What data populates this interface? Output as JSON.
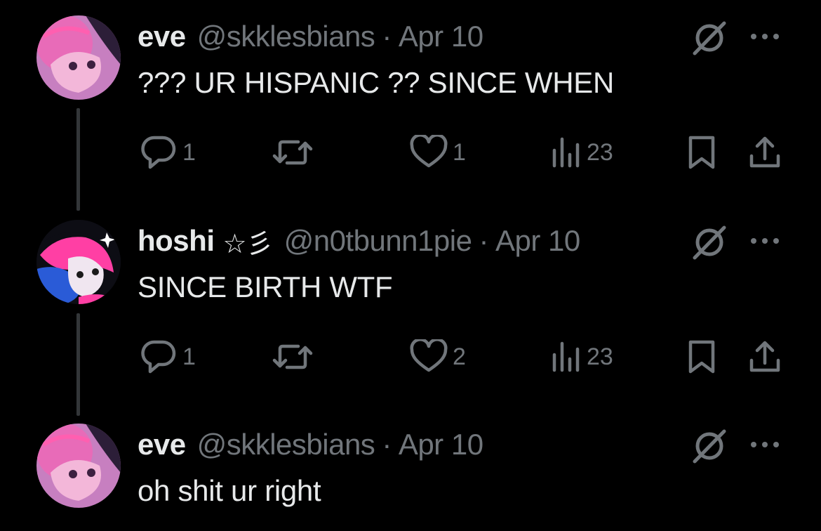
{
  "colors": {
    "background": "#000000",
    "text_primary": "#e7e9ea",
    "text_secondary": "#71767b",
    "thread_line": "#333639",
    "avatar_pink": "#e040a0",
    "avatar_blue": "#2a5bd7"
  },
  "posts": [
    {
      "display_name": "eve",
      "name_decoration": "",
      "handle": "@skklesbians",
      "separator": "·",
      "date": "Apr 10",
      "text": "??? UR HISPANIC ?? SINCE WHEN",
      "replies": "1",
      "reposts": "",
      "likes": "1",
      "views": "23",
      "avatar_icon": "avatar-image",
      "grok_icon": "grok-icon",
      "more_icon": "more-icon"
    },
    {
      "display_name": "hoshi",
      "name_decoration": "☆彡",
      "handle": "@n0tbunn1pie",
      "separator": "·",
      "date": "Apr 10",
      "text": "SINCE BIRTH WTF",
      "replies": "1",
      "reposts": "",
      "likes": "2",
      "views": "23",
      "avatar_icon": "avatar-image",
      "grok_icon": "grok-icon",
      "more_icon": "more-icon"
    },
    {
      "display_name": "eve",
      "name_decoration": "",
      "handle": "@skklesbians",
      "separator": "·",
      "date": "Apr 10",
      "text": "oh shit ur right",
      "avatar_icon": "avatar-image",
      "grok_icon": "grok-icon",
      "more_icon": "more-icon"
    }
  ]
}
